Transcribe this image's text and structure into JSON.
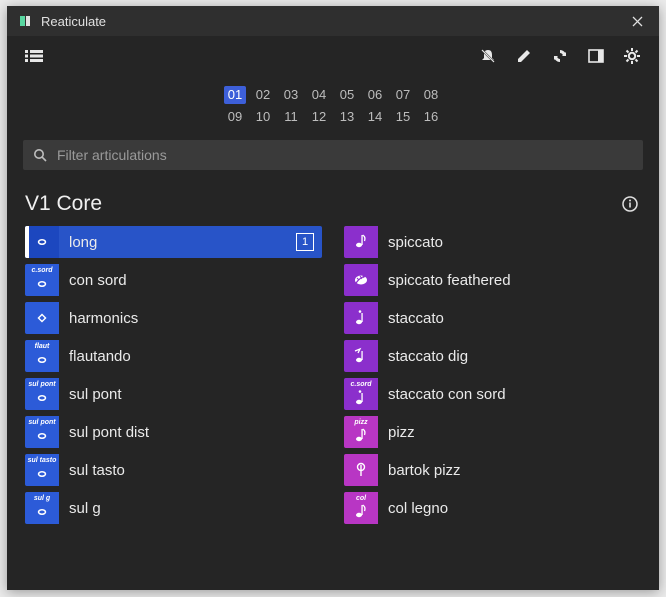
{
  "window": {
    "title": "Reaticulate"
  },
  "toolbar": {
    "icons": [
      "list",
      "mute",
      "edit",
      "sync",
      "dock",
      "settings"
    ]
  },
  "channels": {
    "row1": [
      "01",
      "02",
      "03",
      "04",
      "05",
      "06",
      "07",
      "08"
    ],
    "row2": [
      "09",
      "10",
      "11",
      "12",
      "13",
      "14",
      "15",
      "16"
    ],
    "selected": "01"
  },
  "search": {
    "placeholder": "Filter articulations"
  },
  "section": {
    "title": "V1 Core"
  },
  "columns": [
    {
      "items": [
        {
          "label": "long",
          "color": "blue",
          "top": "",
          "glyph": "whole",
          "selected": true,
          "badge": "1"
        },
        {
          "label": "con sord",
          "color": "blue",
          "top": "c.sord",
          "glyph": "whole"
        },
        {
          "label": "harmonics",
          "color": "blue",
          "top": "",
          "glyph": "diamond"
        },
        {
          "label": "flautando",
          "color": "blue",
          "top": "flaut",
          "glyph": "whole"
        },
        {
          "label": "sul pont",
          "color": "blue",
          "top": "sul pont",
          "glyph": "whole"
        },
        {
          "label": "sul pont dist",
          "color": "blue",
          "top": "sul pont",
          "glyph": "whole"
        },
        {
          "label": "sul tasto",
          "color": "blue",
          "top": "sul tasto",
          "glyph": "whole"
        },
        {
          "label": "sul g",
          "color": "blue",
          "top": "sul g",
          "glyph": "whole"
        }
      ]
    },
    {
      "items": [
        {
          "label": "spiccato",
          "color": "purple",
          "top": "",
          "glyph": "note"
        },
        {
          "label": "spiccato feathered",
          "color": "purple",
          "top": "",
          "glyph": "feather"
        },
        {
          "label": "staccato",
          "color": "purple",
          "top": "",
          "glyph": "dotnote"
        },
        {
          "label": "staccato dig",
          "color": "purple",
          "top": "",
          "glyph": "dig"
        },
        {
          "label": "staccato con sord",
          "color": "purple",
          "top": "c.sord",
          "glyph": "dotnote"
        },
        {
          "label": "pizz",
          "color": "pink",
          "top": "pizz",
          "glyph": "note"
        },
        {
          "label": "bartok pizz",
          "color": "pink",
          "top": "",
          "glyph": "bartok"
        },
        {
          "label": "col legno",
          "color": "pink",
          "top": "col",
          "glyph": "note"
        }
      ]
    }
  ]
}
